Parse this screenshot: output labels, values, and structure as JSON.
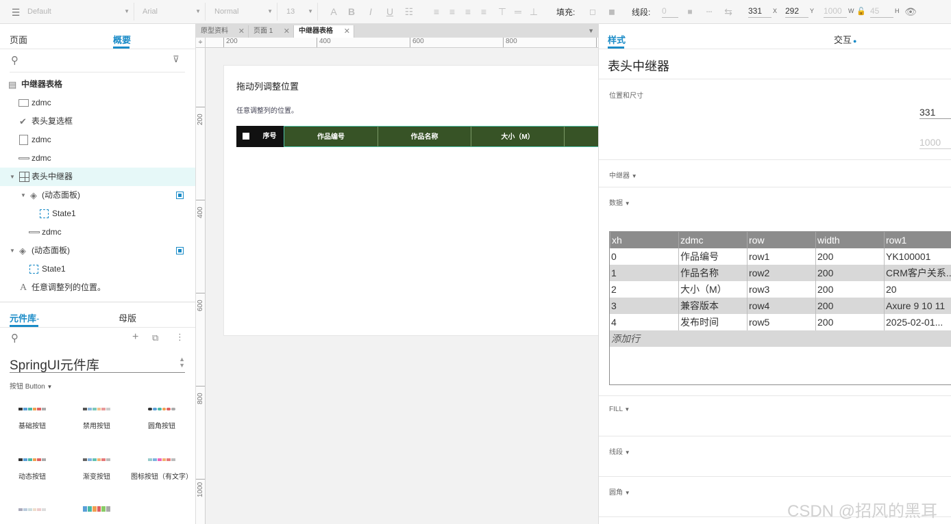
{
  "toolbar": {
    "style_dropdown": "Default",
    "font_dropdown": "Arial",
    "weight_dropdown": "Normal",
    "size_dropdown": "13",
    "fill_label": "填充:",
    "stroke_label": "线段:",
    "stroke_value": "0",
    "x_value": "331",
    "x_unit": "X",
    "y_value": "292",
    "y_unit": "Y",
    "w_value": "1000",
    "w_unit": "W",
    "h_value": "45",
    "h_unit": "H"
  },
  "left_panel": {
    "tabs": [
      "页面",
      "概要"
    ],
    "active_tab": "概要",
    "tree_title": "中继器表格",
    "tree": [
      {
        "label": "zdmc",
        "icon": "rectangle-icon"
      },
      {
        "label": "表头复选框",
        "icon": "checkmark-icon"
      },
      {
        "label": "zdmc",
        "icon": "rectangle-icon"
      },
      {
        "label": "zdmc",
        "icon": "line-icon"
      },
      {
        "label": "表头中继器",
        "icon": "repeater-icon",
        "selected": true
      },
      {
        "label": "(动态面板)",
        "icon": "layers-icon"
      },
      {
        "label": "State1",
        "icon": "dashed-box-icon"
      },
      {
        "label": "zdmc",
        "icon": "line-icon"
      },
      {
        "label": "(动态面板)",
        "icon": "layers-icon"
      },
      {
        "label": "State1",
        "icon": "dashed-box-icon"
      },
      {
        "label": "任意调整列的位置。",
        "icon": "text-icon"
      }
    ],
    "lib_tabs": [
      "元件库",
      "母版"
    ],
    "library_name": "SpringUI元件库",
    "category": "按钮 Button",
    "items": [
      "基础按钮",
      "禁用按钮",
      "圆角按钮",
      "动态按钮",
      "渐变按钮",
      "图标按钮（有文字）"
    ]
  },
  "canvas": {
    "tabs": [
      "原型资料",
      "页面 1",
      "中继器表格"
    ],
    "active_tab": "中继器表格",
    "ruler_h": [
      "200",
      "400",
      "600",
      "800"
    ],
    "ruler_v": [
      "200",
      "400",
      "600",
      "800",
      "1000"
    ],
    "page_title": "拖动列调整位置",
    "page_subtitle": "任意调整列的位置。",
    "grid_headers": [
      "序号",
      "作品编号",
      "作品名称",
      "大小（M）"
    ]
  },
  "right_panel": {
    "tabs": [
      "样式",
      "交互"
    ],
    "active_tab": "样式",
    "element_name": "表头中继器",
    "sections": {
      "pos_size": "位置和尺寸",
      "repeater": "中继器",
      "data": "数据",
      "fill": "FILL",
      "stroke": "线段",
      "corner": "圆角"
    },
    "x_value": "331",
    "w_value": "1000",
    "data_table": {
      "columns": [
        "xh",
        "zdmc",
        "row",
        "width",
        "row1"
      ],
      "rows": [
        [
          "0",
          "作品编号",
          "row1",
          "200",
          "YK100001"
        ],
        [
          "1",
          "作品名称",
          "row2",
          "200",
          "CRM客户关系..."
        ],
        [
          "2",
          "大小（M）",
          "row3",
          "200",
          "20"
        ],
        [
          "3",
          "兼容版本",
          "row4",
          "200",
          "Axure 9 10 11"
        ],
        [
          "4",
          "发布时间",
          "row5",
          "200",
          "2025-02-01..."
        ]
      ],
      "add_row": "添加行"
    }
  },
  "watermark": "CSDN @招风的黑耳",
  "colors": {
    "accent": "#1a8bc7",
    "grid_header": "#375326",
    "grid_header_dark": "#111111",
    "selected_row": "#e6f8f8"
  }
}
